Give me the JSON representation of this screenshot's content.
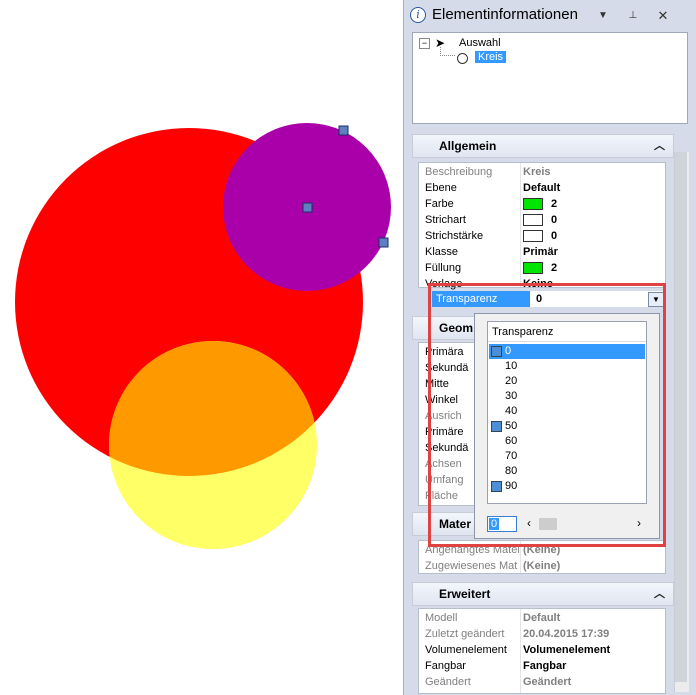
{
  "panel": {
    "title": "Elementinformationen",
    "tree": {
      "root": "Auswahl",
      "child": "Kreis"
    }
  },
  "sections": {
    "allgemein": {
      "title": "Allgemein",
      "rows": [
        {
          "label": "Beschreibung",
          "value": "Kreis",
          "muted": true
        },
        {
          "label": "Ebene",
          "value": "Default"
        },
        {
          "label": "Farbe",
          "value": "2",
          "swatch": "#00e600"
        },
        {
          "label": "Strichart",
          "value": "0",
          "swatch": "#ffffff"
        },
        {
          "label": "Strichstärke",
          "value": "0",
          "swatch": "#ffffff"
        },
        {
          "label": "Klasse",
          "value": "Primär"
        },
        {
          "label": "Füllung",
          "value": "2",
          "swatch": "#00e600"
        },
        {
          "label": "Vorlage",
          "value": "Keine"
        }
      ]
    },
    "geometrie": {
      "title": "Geom",
      "rows": [
        "Primära",
        "Sekundä",
        "Mitte",
        "Winkel",
        "Ausrich",
        "Primäre",
        "Sekundä",
        "Achsen",
        "Umfang",
        "Fläche"
      ]
    },
    "material": {
      "title": "Mater",
      "rows": [
        {
          "label": "Angehängtes Mater",
          "value": "(Keine)"
        },
        {
          "label": "Zugewiesenes Mat",
          "value": "(Keine)"
        }
      ]
    },
    "erweitert": {
      "title": "Erweitert",
      "rows": [
        {
          "label": "Modell",
          "value": "Default",
          "muted": true
        },
        {
          "label": "Zuletzt geändert",
          "value": "20.04.2015 17:39",
          "muted": true
        },
        {
          "label": "Volumenelement",
          "value": "Volumenelement"
        },
        {
          "label": "Fangbar",
          "value": "Fangbar"
        },
        {
          "label": "Geändert",
          "value": "Geändert",
          "muted": true
        }
      ]
    }
  },
  "transparency": {
    "label": "Transparenz",
    "value": "0",
    "list_header": "Transparenz",
    "options": [
      "0",
      "10",
      "20",
      "30",
      "40",
      "50",
      "60",
      "70",
      "80",
      "90"
    ],
    "selected": "0",
    "input_value": "0"
  },
  "colors": {
    "red_circle": "#ff0000",
    "purple_circle": "#aa00aa",
    "yellow_circle": "#ffff66",
    "overlap": "#ff9900",
    "highlight": "#3399ff",
    "frame": "#e04141"
  }
}
